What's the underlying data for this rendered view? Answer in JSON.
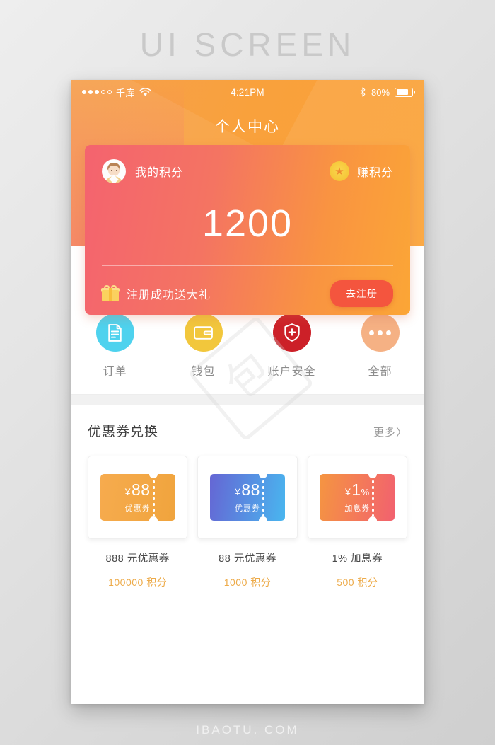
{
  "watermarks": {
    "top": "UI SCREEN",
    "bottom": "IBAOTU. COM"
  },
  "statusbar": {
    "carrier": "千库",
    "signal_dots_filled": 3,
    "signal_dots_hollow": 2,
    "wifi_icon": "wifi-icon",
    "time": "4:21PM",
    "bluetooth_icon": "bluetooth-icon",
    "battery_percent": "80%",
    "battery_icon": "battery-icon"
  },
  "header": {
    "title": "个人中心",
    "bg_color": "#f9a13c"
  },
  "points_card": {
    "avatar_icon": "user-avatar-icon",
    "my_points_label": "我的积分",
    "coin_icon": "star-coin-icon",
    "earn_points_label": "赚积分",
    "points_value": "1200",
    "gift_icon": "gift-icon",
    "promo_text": "注册成功送大礼",
    "register_button": "去注册",
    "gradient_from": "#f4636f",
    "gradient_to": "#fba636",
    "button_color": "#f4553e"
  },
  "quick_actions": [
    {
      "label": "订单",
      "icon": "document-icon",
      "color": "#4ed2ee"
    },
    {
      "label": "钱包",
      "icon": "wallet-icon",
      "color": "#f2c73c"
    },
    {
      "label": "账户安全",
      "icon": "shield-plus-icon",
      "color": "#cc2028"
    },
    {
      "label": "全部",
      "icon": "more-dots-icon",
      "color": "#f5b184"
    }
  ],
  "coupon_section": {
    "title": "优惠券兑换",
    "more_label": "更多〉",
    "coupons": [
      {
        "ticket_amount": "88",
        "ticket_currency": "¥",
        "ticket_suffix": "",
        "ticket_type": "优惠券",
        "name": "888 元优惠券",
        "cost": "100000 积分",
        "color_from": "#f6ab4e",
        "color_to": "#f0a43d"
      },
      {
        "ticket_amount": "88",
        "ticket_currency": "¥",
        "ticket_suffix": "",
        "ticket_type": "优惠券",
        "name": "88 元优惠券",
        "cost": "1000 积分",
        "color_from": "#6566d4",
        "color_to": "#49b6ef"
      },
      {
        "ticket_amount": "1",
        "ticket_currency": "¥",
        "ticket_suffix": "%",
        "ticket_type": "加息券",
        "name": "1% 加息券",
        "cost": "500 积分",
        "color_from": "#f59541",
        "color_to": "#f2616f"
      }
    ]
  }
}
